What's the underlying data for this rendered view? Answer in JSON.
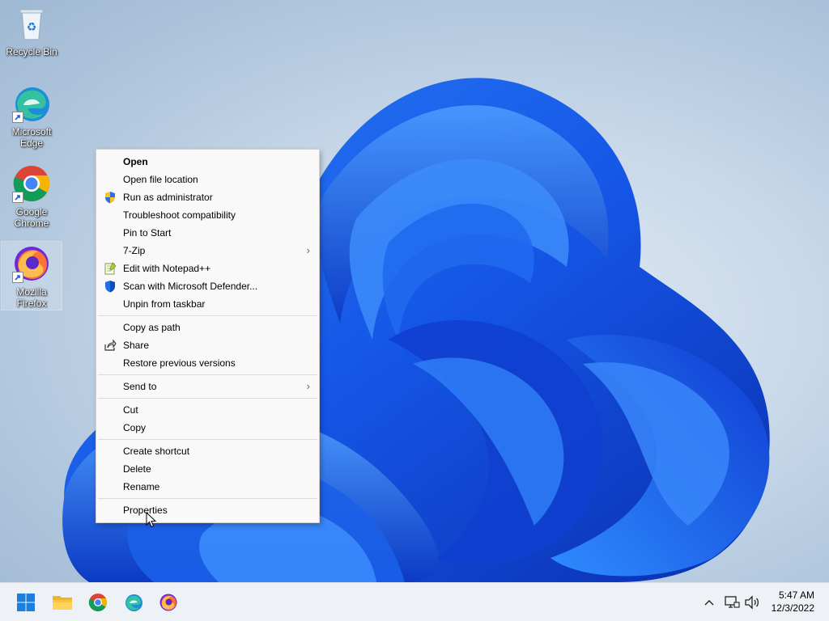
{
  "desktop": {
    "icons": [
      {
        "label": "Recycle Bin"
      },
      {
        "label": "Microsoft Edge"
      },
      {
        "label": "Google Chrome"
      },
      {
        "label": "Mozilla Firefox"
      }
    ]
  },
  "context_menu": {
    "items": [
      {
        "label": "Open",
        "bold": true
      },
      {
        "label": "Open file location"
      },
      {
        "label": "Run as administrator",
        "icon": "uac-shield-icon"
      },
      {
        "label": "Troubleshoot compatibility"
      },
      {
        "label": "Pin to Start"
      },
      {
        "label": "7-Zip",
        "submenu": true
      },
      {
        "label": "Edit with Notepad++",
        "icon": "notepad-plus-plus-icon"
      },
      {
        "label": "Scan with Microsoft Defender...",
        "icon": "defender-shield-icon"
      },
      {
        "label": "Unpin from taskbar"
      },
      {
        "label": "Copy as path"
      },
      {
        "label": "Share",
        "icon": "share-icon"
      },
      {
        "label": "Restore previous versions"
      },
      {
        "label": "Send to",
        "submenu": true
      },
      {
        "label": "Cut"
      },
      {
        "label": "Copy"
      },
      {
        "label": "Create shortcut"
      },
      {
        "label": "Delete"
      },
      {
        "label": "Rename"
      },
      {
        "label": "Properties"
      }
    ],
    "submenu_arrow": "›"
  },
  "taskbar": {
    "apps": [
      "start-icon",
      "file-explorer-icon",
      "chrome-icon",
      "edge-icon",
      "firefox-icon"
    ],
    "tray": {
      "chevron": "^",
      "time": "5:47 AM",
      "date": "12/3/2022"
    }
  },
  "colors": {
    "accent": "#1d5fe0",
    "menu_bg": "#f9f9f9",
    "taskbar_bg": "#eef1f5"
  }
}
